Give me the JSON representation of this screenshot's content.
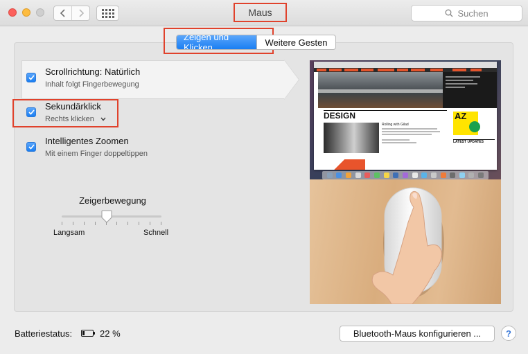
{
  "window": {
    "title": "Maus"
  },
  "toolbar": {
    "back_icon": "chevron-left-icon",
    "forward_icon": "chevron-right-icon",
    "show_all_icon": "grid-icon",
    "search_placeholder": "Suchen"
  },
  "tabs": [
    {
      "label": "Zeigen und Klicken",
      "active": true
    },
    {
      "label": "Weitere Gesten",
      "active": false
    }
  ],
  "options": [
    {
      "title": "Scrollrichtung: Natürlich",
      "subtitle": "Inhalt folgt Fingerbewegung",
      "checked": true
    },
    {
      "title": "Sekundärklick",
      "subtitle": "Rechts klicken",
      "checked": true,
      "has_dropdown": true
    },
    {
      "title": "Intelligentes Zoomen",
      "subtitle": "Mit einem Finger doppeltippen",
      "checked": true
    }
  ],
  "slider": {
    "title": "Zeigerbewegung",
    "min_label": "Langsam",
    "max_label": "Schnell",
    "value_fraction": 0.45,
    "tick_count": 10
  },
  "preview": {
    "screen_heading": "DESIGN",
    "article_heading": "Rolling with Gilad",
    "az_text": "AZ",
    "latest_updates": "LATEST UPDATES"
  },
  "footer": {
    "battery_label": "Batteriestatus:",
    "battery_value": "22 %",
    "battery_level": 0.22,
    "configure_button": "Bluetooth-Maus konfigurieren ...",
    "help_label": "?"
  },
  "colors": {
    "accent": "#1a7ef2",
    "highlight": "#e0422c",
    "close": "#fc605c",
    "minimize": "#fdbc40",
    "zoom_disabled": "#cfcfcf"
  }
}
